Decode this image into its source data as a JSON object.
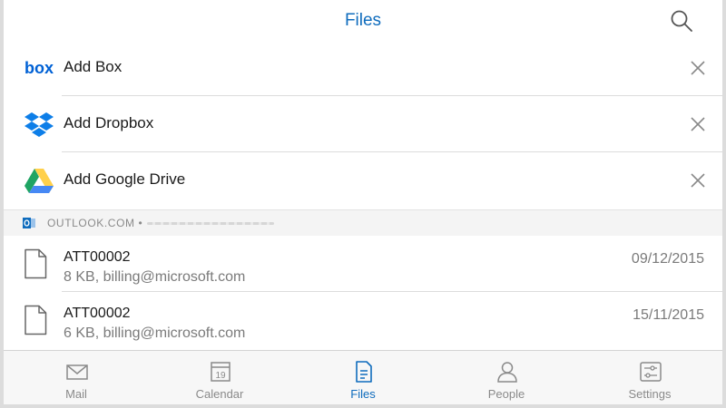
{
  "header": {
    "title": "Files",
    "search_icon": "search-icon"
  },
  "services": [
    {
      "label": "Add Box",
      "icon": "box-logo-icon",
      "color": "#0061d5"
    },
    {
      "label": "Add Dropbox",
      "icon": "dropbox-logo-icon",
      "color": "#0d7ee8"
    },
    {
      "label": "Add Google Drive",
      "icon": "google-drive-logo-icon",
      "colors": [
        "#1fa463",
        "#ffd04b",
        "#4688f4"
      ]
    }
  ],
  "account": {
    "label": "OUTLOOK.COM •",
    "icon": "outlook-icon"
  },
  "files": [
    {
      "name": "ATT00002",
      "meta": "8 KB, billing@microsoft.com",
      "date": "09/12/2015",
      "icon": "document-icon"
    },
    {
      "name": "ATT00002",
      "meta": "6 KB, billing@microsoft.com",
      "date": "15/11/2015",
      "icon": "document-icon"
    }
  ],
  "tabs": [
    {
      "label": "Mail",
      "icon": "mail-icon",
      "active": false
    },
    {
      "label": "Calendar",
      "icon": "calendar-icon",
      "active": false,
      "icon_text": "19"
    },
    {
      "label": "Files",
      "icon": "files-icon",
      "active": true
    },
    {
      "label": "People",
      "icon": "people-icon",
      "active": false
    },
    {
      "label": "Settings",
      "icon": "settings-icon",
      "active": false
    }
  ],
  "colors": {
    "accent": "#0f6cbd",
    "inactive": "#8a8a8a"
  }
}
